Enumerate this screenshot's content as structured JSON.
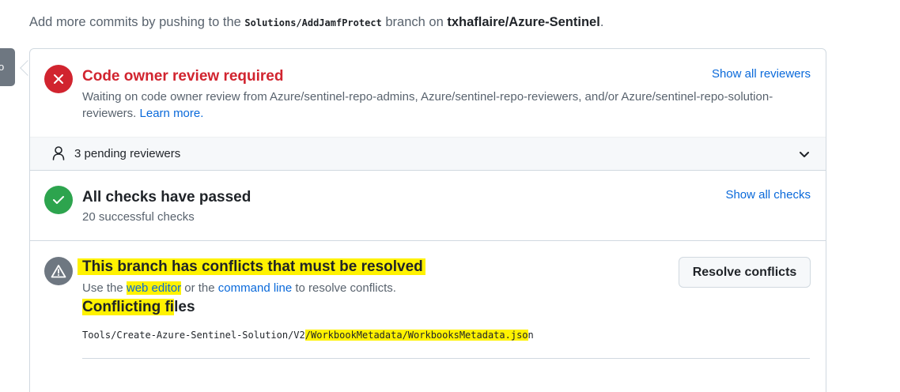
{
  "intro": {
    "prefix": "Add more commits by pushing to the ",
    "branch": "Solutions/AddJamfProtect",
    "middle": " branch on ",
    "repo": "txhaflaire/Azure-Sentinel",
    "suffix": "."
  },
  "review": {
    "title": "Code owner review required",
    "description": "Waiting on code owner review from Azure/sentinel-repo-admins, Azure/sentinel-repo-reviewers, and/or Azure/sentinel-repo-solution-reviewers. ",
    "learn_more": "Learn more.",
    "show_all_label": "Show all reviewers",
    "icon": "x-circle-icon",
    "color": "#d1242f"
  },
  "pending": {
    "label": "3 pending reviewers",
    "icon": "person-icon"
  },
  "checks": {
    "title": "All checks have passed",
    "subtitle": "20 successful checks",
    "show_all_label": "Show all checks",
    "icon": "check-circle-icon",
    "color": "#2da44e"
  },
  "conflicts": {
    "title": "This branch has conflicts that must be resolved",
    "use_the": "Use the ",
    "web_editor": "web editor",
    "or_the": " or the ",
    "command_line": "command line",
    "to_resolve": " to resolve conflicts.",
    "resolve_button": "Resolve conflicts",
    "files_title_hl": "Conflicting fi",
    "files_title_rest": "les",
    "file_path_prefix": "Tools/Create-Azure-Sentinel-Solution/V2",
    "file_path_hl": "/WorkbookMetadata/WorkbooksMetadata.jso",
    "file_path_rest": "n",
    "icon": "alert-icon",
    "highlight_color": "#fff200"
  }
}
